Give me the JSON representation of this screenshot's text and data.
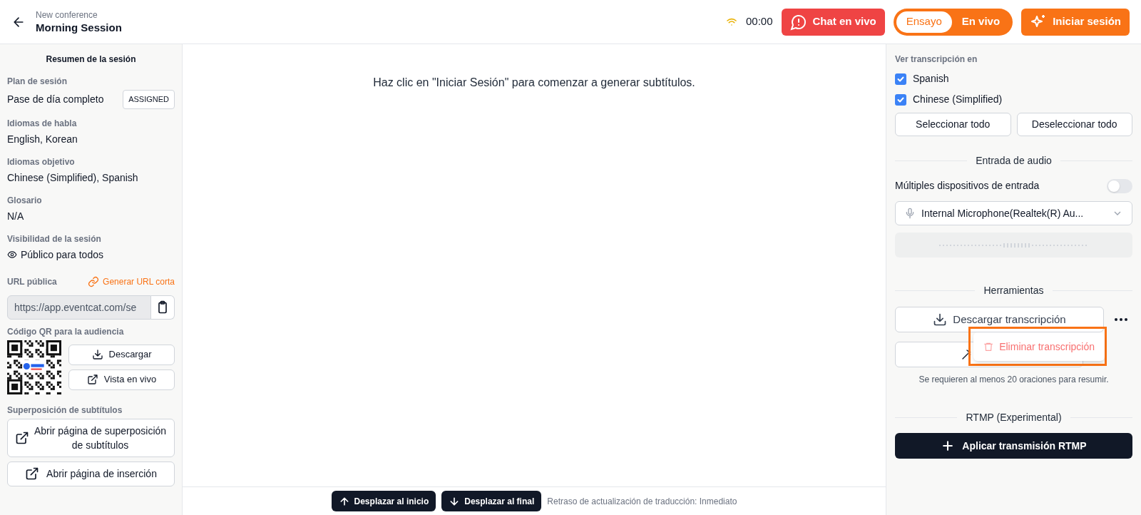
{
  "header": {
    "subtitle": "New conference",
    "title": "Morning Session",
    "timer": "00:00",
    "chat_button": "Chat en vivo",
    "mode_options": [
      {
        "label": "Ensayo",
        "selected": true
      },
      {
        "label": "En vivo",
        "selected": false
      }
    ],
    "start_button": "Iniciar sesión"
  },
  "left_panel": {
    "heading": "Resumen de la sesión",
    "plan": {
      "label": "Plan de sesión",
      "value": "Pase de día completo",
      "badge": "ASSIGNED"
    },
    "fields": [
      {
        "label": "Idiomas de habla",
        "value": "English, Korean"
      },
      {
        "label": "Idiomas objetivo",
        "value": "Chinese (Simplified), Spanish"
      },
      {
        "label": "Glosario",
        "value": "N/A"
      }
    ],
    "visibility": {
      "label": "Visibilidad de la sesión",
      "value": "Público para todos"
    },
    "public_url": {
      "label": "URL pública",
      "link": "Generar URL corta",
      "value": "https://app.eventcat.com/se"
    },
    "qr": {
      "label": "Código QR para la audiencia",
      "buttons": [
        "Descargar",
        "Vista en vivo"
      ]
    },
    "overlay": {
      "label": "Superposición de subtítulos",
      "buttons": [
        "Abrir página de superposición de subtítulos",
        "Abrir página de inserción"
      ]
    }
  },
  "main": {
    "message": "Haz clic en \"Iniciar Sesión\" para comenzar a generar subtítulos.",
    "footer": {
      "buttons": [
        "Desplazar al inicio",
        "Desplazar al final"
      ],
      "note": "Retraso de actualización de traducción: Inmediato"
    }
  },
  "right_panel": {
    "transcript_label": "Ver transcripción en",
    "languages": [
      {
        "label": "Spanish",
        "checked": true
      },
      {
        "label": "Chinese (Simplified)",
        "checked": true
      }
    ],
    "select_buttons": [
      "Seleccionar todo",
      "Deseleccionar todo"
    ],
    "audio": {
      "heading": "Entrada de audio",
      "multi_label": "Múltiples dispositivos de entrada",
      "multi_on": false,
      "device": "Internal Microphone(Realtek(R) Au..."
    },
    "tools": {
      "heading": "Herramientas",
      "download_button": "Descargar transcripción",
      "menu_item": "Eliminar transcripción",
      "note": "Se requieren al menos 20 oraciones para resumir."
    },
    "rtmp": {
      "heading": "RTMP (Experimental)",
      "button": "Aplicar transmisión RTMP"
    }
  }
}
